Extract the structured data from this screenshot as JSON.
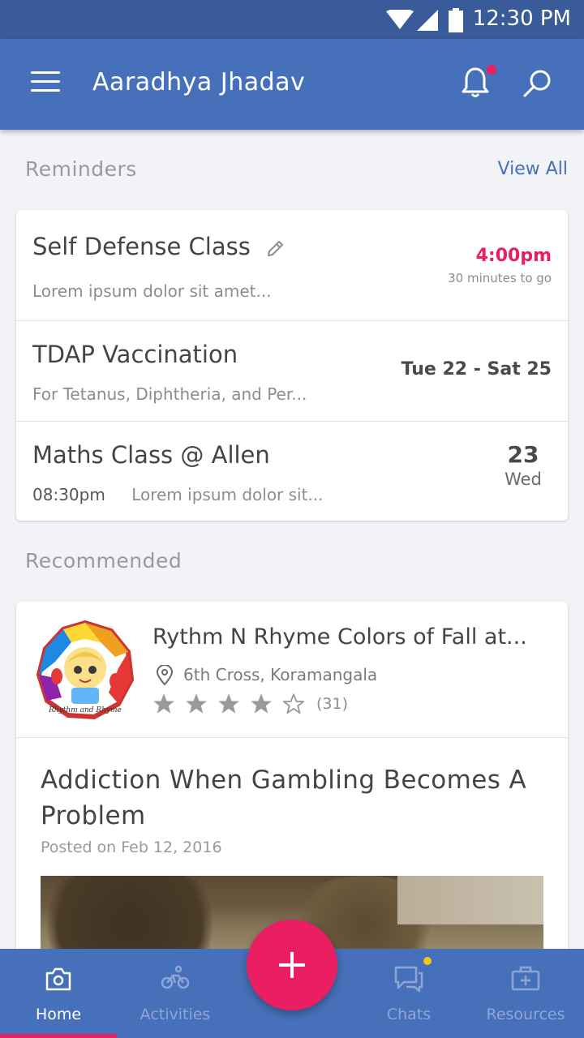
{
  "status_bar": {
    "time": "12:30 PM"
  },
  "app_bar": {
    "title": "Aaradhya Jhadav",
    "notification_dot_color": "#e91e63"
  },
  "reminders": {
    "section_title": "Reminders",
    "view_all": "View All",
    "items": [
      {
        "title": "Self Defense Class",
        "subtitle": "Lorem ipsum dolor sit amet...",
        "time": "4:00pm",
        "time_color": "#e91e63",
        "time_note": "30 minutes to go"
      },
      {
        "title": "TDAP Vaccination",
        "subtitle": "For Tetanus, Diphtheria, and Per...",
        "date_range": "Tue 22 - Sat 25"
      },
      {
        "title": "Maths Class @ Allen",
        "time": "08:30pm",
        "subtitle": "Lorem ipsum dolor sit...",
        "day_number": "23",
        "day_name": "Wed"
      }
    ]
  },
  "recommended": {
    "section_title": "Recommended",
    "event": {
      "title": "Rythm N Rhyme Colors of Fall at...",
      "location": "6th Cross, Koramangala",
      "rating": 4,
      "rating_max": 5,
      "rating_count": "(31)",
      "logo_text": "Rhythm and Rhyme"
    },
    "article": {
      "title": "Addiction When Gambling Becomes A Problem",
      "posted": "Posted on Feb 12, 2016"
    }
  },
  "bottom_nav": {
    "items": [
      {
        "label": "Home",
        "icon": "camera-home-icon",
        "active": true
      },
      {
        "label": "Activities",
        "icon": "bicycle-icon",
        "active": false
      },
      {
        "label": "Chats",
        "icon": "chat-icon",
        "active": false
      },
      {
        "label": "Resources",
        "icon": "briefcase-plus-icon",
        "active": false
      }
    ],
    "accent_color": "#e91e63"
  },
  "colors": {
    "primary": "#4670b9",
    "status_bar": "#3a5b9a",
    "accent": "#e91e63"
  }
}
